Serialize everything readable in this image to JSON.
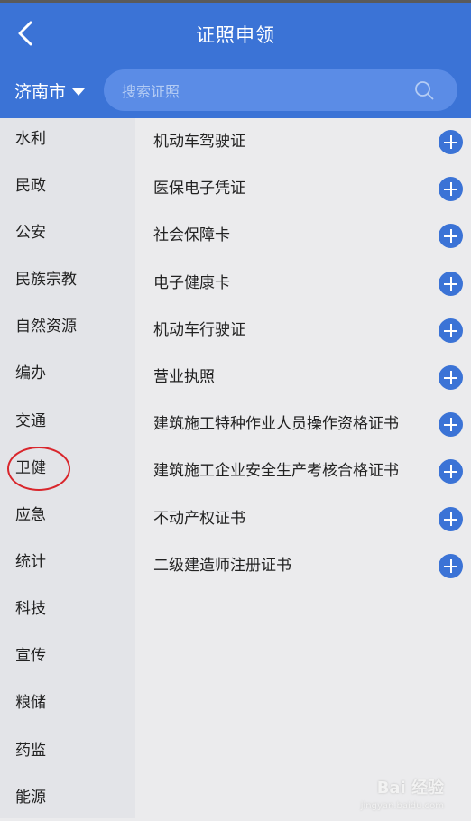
{
  "header": {
    "title": "证照申领",
    "city": "济南市",
    "search_placeholder": "搜索证照"
  },
  "sidebar": {
    "items": [
      "水利",
      "民政",
      "公安",
      "民族宗教",
      "自然资源",
      "编办",
      "交通",
      "卫健",
      "应急",
      "统计",
      "科技",
      "宣传",
      "粮储",
      "药监",
      "能源"
    ]
  },
  "licenses": [
    "机动车驾驶证",
    "医保电子凭证",
    "社会保障卡",
    "电子健康卡",
    "机动车行驶证",
    "营业执照",
    "建筑施工特种作业人员操作资格证书",
    "建筑施工企业安全生产考核合格证书",
    "不动产权证书",
    "二级建造师注册证书"
  ],
  "colors": {
    "accent": "#3b73d6",
    "annotation": "#d9262c"
  },
  "watermark": {
    "brand": "Bai 经验",
    "url": "jingyan.baidu.com"
  }
}
